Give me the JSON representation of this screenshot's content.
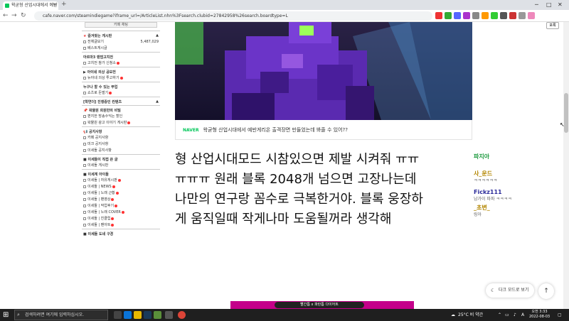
{
  "browser": {
    "tab_title": "왁굳형 산업시대에서 예반",
    "url": "cafe.naver.com/steamindiegame?iframe_url=/ArticleList.nhn%3Fsearch.clubid=27842958%26search.boardtype=L",
    "topright_button": "포록"
  },
  "sidebar": {
    "write_label": "카페 채팅",
    "fav_section": "즐겨찾는 게시판",
    "all_posts": "전체글보기",
    "all_count": "5,487,029",
    "best": "베스트게시글",
    "sec1": "아르마3 랜덤고치전",
    "sec1_item": "고치전 참가 신청소",
    "sec2": "아이네 의상 공모전",
    "sec2_item": "뉴아네 의상 투고하기",
    "sec3": "누구나 할 수 있는 부업",
    "sec3_item": "쇼츠로 돈벌기",
    "sec4": "[학연더] 진행중인 컨텐츠",
    "sec5": "왁물원 회원만의 비밀",
    "sec5_item1": "편지한 방송수익는 할인",
    "sec5_item2": "왁물원 광고 이야기 게시판",
    "sec6": "공지사항",
    "sec6_item1": "카페 공지사항",
    "sec6_item2": "미크 공지사항",
    "sec6_item3": "이세돌 공지사항",
    "sec7": "이세돌이 직접 쓴 글",
    "sec7_item": "이세돌 게시판",
    "sec8": "이세계 아이돌",
    "sec8_items": [
      "이세돌 | 자유게시판",
      "이세돌 | NEWS",
      "이세돌 | 노래 근황",
      "이세돌 | 팬영상",
      "이세돌 | 작업후기",
      "이세돌 | 노래 COVER",
      "이세돌 | 친클립",
      "이세돌 | 팬아트"
    ],
    "sec9": "이세돌 도네 구경"
  },
  "article": {
    "caption_source": "NAVER",
    "caption_text": "왁굳형 산업시대에서 예반게리온 출격장면 만들었는데 봐줄 수 있어??",
    "lines": [
      "형 산업시대모드 시참있으면 제발 시켜줘 ㅠㅠ",
      "ㅠㅠㅠ 원래 블록 2048개 넘으면 고장나는데",
      "나만의 연구랑 꼼수로 극복한거야. 블록 웅장하",
      "게 움직일때 작게나마 도움될꺼라 생각해"
    ],
    "banner_text": "빨간틈 x 파란틈 다이어트"
  },
  "chat": [
    {
      "name": "파지아",
      "msg": "",
      "color": "#1d9a3e"
    },
    {
      "name": "사_운드",
      "msg": "ㅋㅋㅋㅋㅋㅋ",
      "color": "#b38600"
    },
    {
      "name": "Fickz111",
      "msg": "남가이 파파 ㅋㅋㅋㅋ",
      "color": "#2b2b9a"
    },
    {
      "name": "_초변_",
      "msg": "링아",
      "color": "#b38600"
    }
  ],
  "floating": {
    "dark_mode": "다크 모드로 보기",
    "top_arrow": "↑"
  },
  "taskbar": {
    "search_placeholder": "검색하려면 여기에 입력하십시오.",
    "weather": "25°C 비 약간",
    "time": "오전 3:33",
    "date": "2022-08-03"
  }
}
